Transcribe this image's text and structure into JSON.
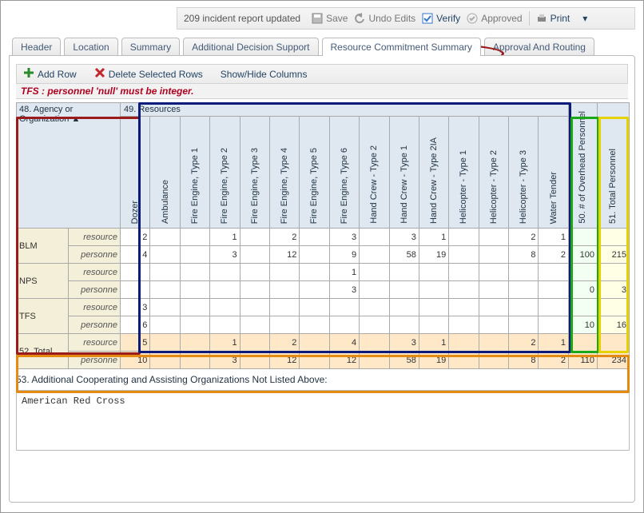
{
  "toolbar": {
    "status": "209 incident report updated",
    "save": "Save",
    "undo": "Undo Edits",
    "verify": "Verify",
    "approve": "Approved",
    "print": "Print"
  },
  "tabs": {
    "items": [
      {
        "label": "Header"
      },
      {
        "label": "Location"
      },
      {
        "label": "Summary"
      },
      {
        "label": "Additional Decision Support"
      },
      {
        "label": "Resource Commitment Summary"
      },
      {
        "label": "Approval And Routing"
      }
    ],
    "active_index": 4
  },
  "actions": {
    "add_row": "Add Row",
    "delete_rows": "Delete Selected Rows",
    "show_hide": "Show/Hide Columns"
  },
  "error": "TFS : personnel 'null' must be integer.",
  "grid": {
    "topleft": "48. Agency or Organization",
    "super_header": "49. Resources",
    "columns": [
      "Dozer",
      "Ambulance",
      "Fire Engine, Type 1",
      "Fire Engine, Type 2",
      "Fire Engine, Type 3",
      "Fire Engine, Type 4",
      "Fire Engine, Type 5",
      "Fire Engine, Type 6",
      "Hand Crew - Type 2",
      "Hand Crew - Type 1",
      "Hand Crew - Type 2IA",
      "Helicopter - Type 1",
      "Helicopter - Type 2",
      "Helicopter - Type 3",
      "Water Tender"
    ],
    "col_overhead": "50. # of Overhead Personnel",
    "col_total": "51. Total Personnel",
    "row_labels": {
      "resources": "resource",
      "personnel": "personne"
    },
    "agencies": [
      {
        "name": "BLM",
        "resources": [
          "2",
          "",
          "",
          "1",
          "",
          "2",
          "",
          "3",
          "",
          "3",
          "1",
          "",
          "",
          "2",
          "1",
          "",
          ""
        ],
        "personnel": [
          "4",
          "",
          "",
          "3",
          "",
          "12",
          "",
          "9",
          "",
          "58",
          "19",
          "",
          "",
          "8",
          "2",
          "100",
          "215"
        ]
      },
      {
        "name": "NPS",
        "resources": [
          "",
          "",
          "",
          "",
          "",
          "",
          "",
          "1",
          "",
          "",
          "",
          "",
          "",
          "",
          "",
          "",
          ""
        ],
        "personnel": [
          "",
          "",
          "",
          "",
          "",
          "",
          "",
          "3",
          "",
          "",
          "",
          "",
          "",
          "",
          "",
          "0",
          "3"
        ]
      },
      {
        "name": "TFS",
        "resources": [
          "3",
          "",
          "",
          "",
          "",
          "",
          "",
          "",
          "",
          "",
          "",
          "",
          "",
          "",
          "",
          "",
          ""
        ],
        "personnel": [
          "6",
          "",
          "",
          "",
          "",
          "",
          "",
          "",
          "",
          "",
          "",
          "",
          "",
          "",
          "",
          "10",
          "16"
        ]
      }
    ],
    "total_label": "52. Total",
    "total": {
      "resources": [
        "5",
        "",
        "",
        "1",
        "",
        "2",
        "",
        "4",
        "",
        "3",
        "1",
        "",
        "",
        "2",
        "1",
        "",
        ""
      ],
      "personnel": [
        "10",
        "",
        "",
        "3",
        "",
        "12",
        "",
        "12",
        "",
        "58",
        "19",
        "",
        "",
        "8",
        "2",
        "110",
        "234"
      ]
    }
  },
  "coop": {
    "label": "53. Additional Cooperating and Assisting Organizations Not Listed Above:",
    "value": "American Red Cross"
  }
}
